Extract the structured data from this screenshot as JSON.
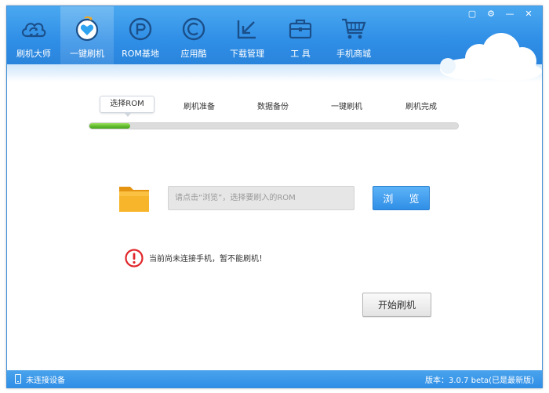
{
  "nav": {
    "items": [
      {
        "label": "刷机大师",
        "icon": "cloud-refresh-icon",
        "active": false
      },
      {
        "label": "一键刷机",
        "icon": "heart-badge-icon",
        "active": true
      },
      {
        "label": "ROM基地",
        "icon": "r-circle-icon",
        "active": false
      },
      {
        "label": "应用酷",
        "icon": "c-circle-icon",
        "active": false
      },
      {
        "label": "下载管理",
        "icon": "download-arrow-icon",
        "active": false
      },
      {
        "label": "工 具",
        "icon": "toolbox-icon",
        "active": false
      },
      {
        "label": "手机商城",
        "icon": "shopping-cart-icon",
        "active": false
      }
    ]
  },
  "window_controls": {
    "restore": "▢",
    "settings": "⚙",
    "minimize": "—",
    "close": "✕"
  },
  "steps": {
    "items": [
      "选择ROM",
      "刷机准备",
      "数据备份",
      "一键刷机",
      "刷机完成"
    ],
    "active_index": 0,
    "progress": 0.11
  },
  "file": {
    "placeholder": "请点击“浏览”，选择要刷入的ROM",
    "value": "",
    "browse_label": "浏 览"
  },
  "warning": {
    "text": "当前尚未连接手机，暂不能刷机！"
  },
  "start_button": "开始刷机",
  "status": {
    "connection": "未连接设备",
    "version": "版本：3.0.7 beta(已是最新版)"
  },
  "colors": {
    "header": "#2f8ee6",
    "progress": "#5cb82b",
    "warning": "#e0262b",
    "folder": "#f5a81c"
  }
}
